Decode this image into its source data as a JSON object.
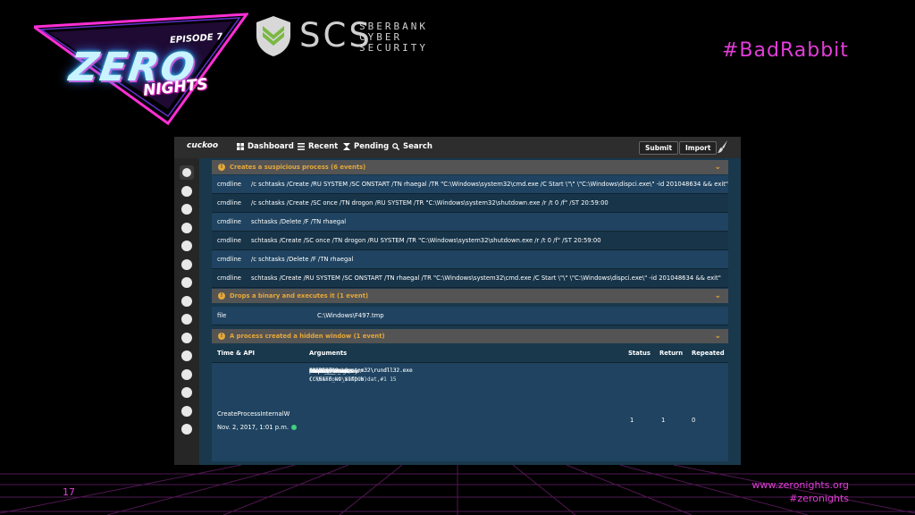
{
  "slide": {
    "episode": "EPISODE 7",
    "logo_zero": "ZERO",
    "logo_nights": "NIGHTS",
    "scs_abbrev": "SCS",
    "scs_name_lines": [
      "SBERBANK",
      "CYBER",
      "SECURITY"
    ],
    "hashtag": "#BadRabbit",
    "page_number": "17",
    "site": "www.zeronights.org",
    "site_tag": "#zeronights",
    "accent_color": "#e23ed9"
  },
  "app": {
    "brand": "cuckoo",
    "nav": [
      {
        "label": "Dashboard",
        "icon": "dashboard-icon"
      },
      {
        "label": "Recent",
        "icon": "list-icon"
      },
      {
        "label": "Pending",
        "icon": "hourglass-icon"
      },
      {
        "label": "Search",
        "icon": "search-icon"
      }
    ],
    "submit_label": "Submit",
    "import_label": "Import",
    "signatures": [
      {
        "title": "Creates a suspicious process (6 events)",
        "rows": [
          {
            "key": "cmdline",
            "value": "/c schtasks /Create /RU SYSTEM /SC ONSTART /TN rhaegal /TR \"C:\\Windows\\system32\\cmd.exe /C Start \\\"\\\" \\\"C:\\Windows\\dispci.exe\\\" -id 201048634 && exit\""
          },
          {
            "key": "cmdline",
            "value": "/c schtasks /Create /SC once /TN drogon /RU SYSTEM /TR \"C:\\Windows\\system32\\shutdown.exe /r /t 0 /f\" /ST 20:59:00"
          },
          {
            "key": "cmdline",
            "value": "schtasks /Delete /F /TN rhaegal"
          },
          {
            "key": "cmdline",
            "value": "schtasks /Create /SC once /TN drogon /RU SYSTEM /TR \"C:\\Windows\\system32\\shutdown.exe /r /t 0 /f\" /ST 20:59:00"
          },
          {
            "key": "cmdline",
            "value": "/c schtasks /Delete /F /TN rhaegal"
          },
          {
            "key": "cmdline",
            "value": "schtasks /Create /RU SYSTEM /SC ONSTART /TN rhaegal /TR \"C:\\Windows\\system32\\cmd.exe /C Start \\\"\\\" \\\"C:\\Windows\\dispci.exe\\\" -id 201048634 && exit\""
          }
        ]
      },
      {
        "title": "Drops a binary and executes it (1 event)",
        "rows": [
          {
            "key": "file",
            "value": "C:\\Windows\\F497.tmp"
          }
        ]
      },
      {
        "title": "A process created a hidden window (1 event)"
      }
    ],
    "table": {
      "headers": [
        "Time & API",
        "Arguments",
        "Status",
        "Return",
        "Repeated"
      ],
      "api": "CreateProcessInternalW",
      "time": "Nov. 2, 2017, 1:01 p.m.",
      "status": "1",
      "return": "1",
      "repeated": "0",
      "args": [
        {
          "k": "thread_identifier:",
          "v": "2456"
        },
        {
          "k": "thread_handle:",
          "v": "0x0000008c"
        },
        {
          "k": "process_identifier:",
          "v": "2452"
        },
        {
          "k": "current_directory:",
          "v": ""
        },
        {
          "k": "filepath:",
          "v": "C:\\Windows\\System32\\rundll32.exe"
        },
        {
          "k": "track:",
          "v": "1"
        },
        {
          "k": "command_line:",
          "v": "C:\\Windows\\system32\\rundll32.exe C:\\Windows\\infpub.dat,#1 15"
        },
        {
          "k": "filepath_r:",
          "v": "C:\\Windows\\system32\\rundll32.exe"
        },
        {
          "k": "stack_pivoted:",
          "v": "0"
        },
        {
          "k": "creation_flags:",
          "v": "134217728 (CREATE_NO_WINDOW)"
        },
        {
          "k": "inherit_handles:",
          "v": "0"
        }
      ]
    }
  }
}
